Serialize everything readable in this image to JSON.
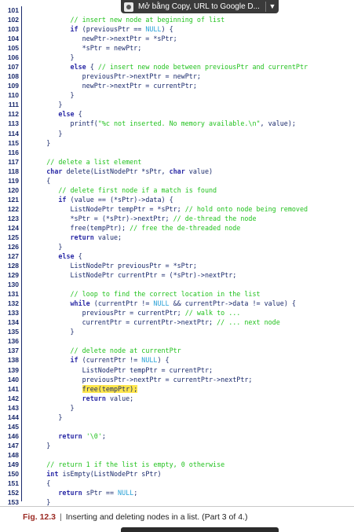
{
  "toolbar": {
    "label": "Mở bằng Copy, URL to Google D...",
    "icon": "page-icon",
    "menu_icon": "chevron-down-icon"
  },
  "lines": [
    {
      "n": "101",
      "t": []
    },
    {
      "n": "102",
      "t": [
        {
          "s": "            "
        },
        {
          "s": "// insert new node at beginning of list",
          "c": "c"
        }
      ]
    },
    {
      "n": "103",
      "t": [
        {
          "s": "            "
        },
        {
          "s": "if",
          "c": "k"
        },
        {
          "s": " (previousPtr == "
        },
        {
          "s": "NULL",
          "c": "n"
        },
        {
          "s": ") {"
        }
      ]
    },
    {
      "n": "104",
      "t": [
        {
          "s": "               newPtr->nextPtr = *sPtr;"
        }
      ]
    },
    {
      "n": "105",
      "t": [
        {
          "s": "               *sPtr = newPtr;"
        }
      ]
    },
    {
      "n": "106",
      "t": [
        {
          "s": "            }"
        }
      ]
    },
    {
      "n": "107",
      "t": [
        {
          "s": "            "
        },
        {
          "s": "else",
          "c": "k"
        },
        {
          "s": " { "
        },
        {
          "s": "// insert new node between previousPtr and currentPtr",
          "c": "c"
        }
      ]
    },
    {
      "n": "108",
      "t": [
        {
          "s": "               previousPtr->nextPtr = newPtr;"
        }
      ]
    },
    {
      "n": "109",
      "t": [
        {
          "s": "               newPtr->nextPtr = currentPtr;"
        }
      ]
    },
    {
      "n": "110",
      "t": [
        {
          "s": "            }"
        }
      ]
    },
    {
      "n": "111",
      "t": [
        {
          "s": "         }"
        }
      ]
    },
    {
      "n": "112",
      "t": [
        {
          "s": "         "
        },
        {
          "s": "else",
          "c": "k"
        },
        {
          "s": " {"
        }
      ]
    },
    {
      "n": "113",
      "t": [
        {
          "s": "            printf("
        },
        {
          "s": "\"%c not inserted. No memory available.\\n\"",
          "c": "s"
        },
        {
          "s": ", value);"
        }
      ]
    },
    {
      "n": "114",
      "t": [
        {
          "s": "         }"
        }
      ]
    },
    {
      "n": "115",
      "t": [
        {
          "s": "      }"
        }
      ]
    },
    {
      "n": "116",
      "t": []
    },
    {
      "n": "117",
      "t": [
        {
          "s": "      "
        },
        {
          "s": "// delete a list element",
          "c": "c"
        }
      ]
    },
    {
      "n": "118",
      "t": [
        {
          "s": "      "
        },
        {
          "s": "char",
          "c": "k"
        },
        {
          "s": " delete(ListNodePtr *sPtr, "
        },
        {
          "s": "char",
          "c": "k"
        },
        {
          "s": " value)"
        }
      ]
    },
    {
      "n": "119",
      "t": [
        {
          "s": "      {"
        }
      ]
    },
    {
      "n": "120",
      "t": [
        {
          "s": "         "
        },
        {
          "s": "// delete first node if a match is found",
          "c": "c"
        }
      ]
    },
    {
      "n": "121",
      "t": [
        {
          "s": "         "
        },
        {
          "s": "if",
          "c": "k"
        },
        {
          "s": " (value == (*sPtr)->data) {"
        }
      ]
    },
    {
      "n": "122",
      "t": [
        {
          "s": "            ListNodePtr tempPtr = *sPtr; "
        },
        {
          "s": "// hold onto node being removed",
          "c": "c"
        }
      ]
    },
    {
      "n": "123",
      "t": [
        {
          "s": "            *sPtr = (*sPtr)->nextPtr; "
        },
        {
          "s": "// de-thread the node",
          "c": "c"
        }
      ]
    },
    {
      "n": "124",
      "t": [
        {
          "s": "            free(tempPtr); "
        },
        {
          "s": "// free the de-threaded node",
          "c": "c"
        }
      ]
    },
    {
      "n": "125",
      "t": [
        {
          "s": "            "
        },
        {
          "s": "return",
          "c": "k"
        },
        {
          "s": " value;"
        }
      ]
    },
    {
      "n": "126",
      "t": [
        {
          "s": "         }"
        }
      ]
    },
    {
      "n": "127",
      "t": [
        {
          "s": "         "
        },
        {
          "s": "else",
          "c": "k"
        },
        {
          "s": " {"
        }
      ]
    },
    {
      "n": "128",
      "t": [
        {
          "s": "            ListNodePtr previousPtr = *sPtr;"
        }
      ]
    },
    {
      "n": "129",
      "t": [
        {
          "s": "            ListNodePtr currentPtr = (*sPtr)->nextPtr;"
        }
      ]
    },
    {
      "n": "130",
      "t": []
    },
    {
      "n": "131",
      "t": [
        {
          "s": "            "
        },
        {
          "s": "// loop to find the correct location in the list",
          "c": "c"
        }
      ]
    },
    {
      "n": "132",
      "t": [
        {
          "s": "            "
        },
        {
          "s": "while",
          "c": "k"
        },
        {
          "s": " (currentPtr != "
        },
        {
          "s": "NULL",
          "c": "n"
        },
        {
          "s": " && currentPtr->data != value) {"
        }
      ]
    },
    {
      "n": "133",
      "t": [
        {
          "s": "               previousPtr = currentPtr; "
        },
        {
          "s": "// walk to ...",
          "c": "c"
        }
      ]
    },
    {
      "n": "134",
      "t": [
        {
          "s": "               currentPtr = currentPtr->nextPtr; "
        },
        {
          "s": "// ... next node",
          "c": "c"
        }
      ]
    },
    {
      "n": "135",
      "t": [
        {
          "s": "            }"
        }
      ]
    },
    {
      "n": "136",
      "t": []
    },
    {
      "n": "137",
      "t": [
        {
          "s": "            "
        },
        {
          "s": "// delete node at currentPtr",
          "c": "c"
        }
      ]
    },
    {
      "n": "138",
      "t": [
        {
          "s": "            "
        },
        {
          "s": "if",
          "c": "k"
        },
        {
          "s": " (currentPtr != "
        },
        {
          "s": "NULL",
          "c": "n"
        },
        {
          "s": ") {"
        }
      ]
    },
    {
      "n": "139",
      "t": [
        {
          "s": "               ListNodePtr tempPtr = currentPtr;"
        }
      ]
    },
    {
      "n": "140",
      "t": [
        {
          "s": "               previousPtr->nextPtr = currentPtr->nextPtr;"
        }
      ]
    },
    {
      "n": "141",
      "t": [
        {
          "s": "               "
        },
        {
          "s": "free(tempPtr);",
          "c": "hl"
        }
      ]
    },
    {
      "n": "142",
      "t": [
        {
          "s": "               "
        },
        {
          "s": "return",
          "c": "k"
        },
        {
          "s": " value;"
        }
      ]
    },
    {
      "n": "143",
      "t": [
        {
          "s": "            }"
        }
      ]
    },
    {
      "n": "144",
      "t": [
        {
          "s": "         }"
        }
      ]
    },
    {
      "n": "145",
      "t": []
    },
    {
      "n": "146",
      "t": [
        {
          "s": "         "
        },
        {
          "s": "return",
          "c": "k"
        },
        {
          "s": " "
        },
        {
          "s": "'\\0'",
          "c": "s"
        },
        {
          "s": ";"
        }
      ]
    },
    {
      "n": "147",
      "t": [
        {
          "s": "      }"
        }
      ]
    },
    {
      "n": "148",
      "t": []
    },
    {
      "n": "149",
      "t": [
        {
          "s": "      "
        },
        {
          "s": "// return 1 if the list is empty, 0 otherwise",
          "c": "c"
        }
      ]
    },
    {
      "n": "150",
      "t": [
        {
          "s": "      "
        },
        {
          "s": "int",
          "c": "k"
        },
        {
          "s": " isEmpty(ListNodePtr sPtr)"
        }
      ]
    },
    {
      "n": "151",
      "t": [
        {
          "s": "      {"
        }
      ]
    },
    {
      "n": "152",
      "t": [
        {
          "s": "         "
        },
        {
          "s": "return",
          "c": "k"
        },
        {
          "s": " sPtr == "
        },
        {
          "s": "NULL",
          "c": "n"
        },
        {
          "s": ";"
        }
      ]
    },
    {
      "n": "153",
      "t": [
        {
          "s": "      }"
        }
      ]
    }
  ],
  "caption": {
    "fig": "Fig. 12.3",
    "separator": "|",
    "text": "Inserting and deleting nodes in a list. (Part 3 of 4.)"
  },
  "colors": {
    "keyword": "#2a2aa6",
    "comment": "#23c21f",
    "constant": "#2aa1d6",
    "highlight": "#ffe64c",
    "fig_label": "#9b2a23"
  }
}
